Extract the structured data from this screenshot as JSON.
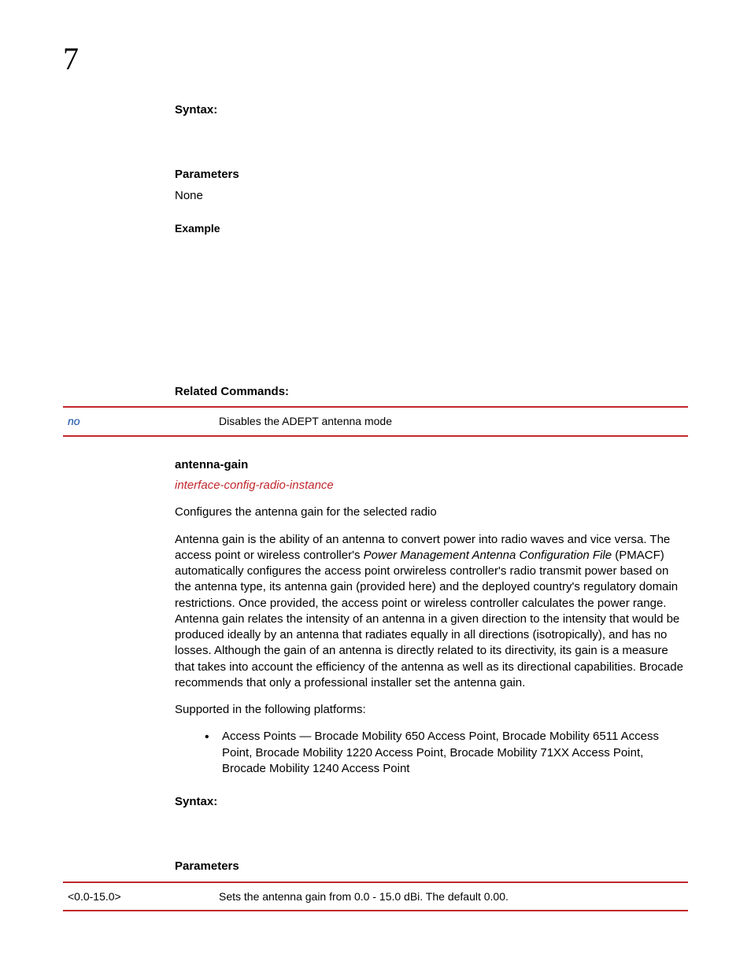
{
  "chapter_number": "7",
  "section1": {
    "syntax_heading": "Syntax:",
    "parameters_heading": "Parameters",
    "parameters_text": "None",
    "example_heading": "Example",
    "related_heading": "Related Commands:",
    "related_row": {
      "key": "no",
      "desc": "Disables the ADEPT antenna mode"
    }
  },
  "section2": {
    "command_name": "antenna-gain",
    "context_link": "interface-config-radio-instance",
    "intro": "Configures the antenna gain for the selected radio",
    "para_a": "Antenna gain is the ability of an antenna to convert power into radio waves and vice versa. The access point or wireless controller's ",
    "para_a_ital": "Power Management Antenna Configuration File",
    "para_a2": " (PMACF) automatically configures the access point orwireless controller's radio transmit power based on the antenna type, its antenna gain (provided here) and the deployed country's regulatory domain restrictions. Once provided, the access point or wireless controller calculates the power range. Antenna gain relates the intensity of an antenna in a given direction to the intensity that would be produced ideally by an antenna that radiates equally in all directions (isotropically), and has no losses. Although the gain of an antenna is directly related to its directivity, its gain is a measure that takes into account the efficiency of the antenna as well as its directional capabilities. Brocade recommends that only a professional installer set the antenna gain.",
    "supported_line": "Supported in the following platforms:",
    "platform_bullet": "Access Points — Brocade Mobility 650 Access Point, Brocade Mobility 6511 Access Point, Brocade Mobility 1220 Access Point, Brocade Mobility 71XX Access Point, Brocade Mobility 1240 Access Point",
    "syntax_heading": "Syntax:",
    "parameters_heading": "Parameters",
    "param_row": {
      "key": "<0.0-15.0>",
      "desc": "Sets the antenna gain from 0.0 - 15.0 dBi. The default 0.00."
    }
  }
}
